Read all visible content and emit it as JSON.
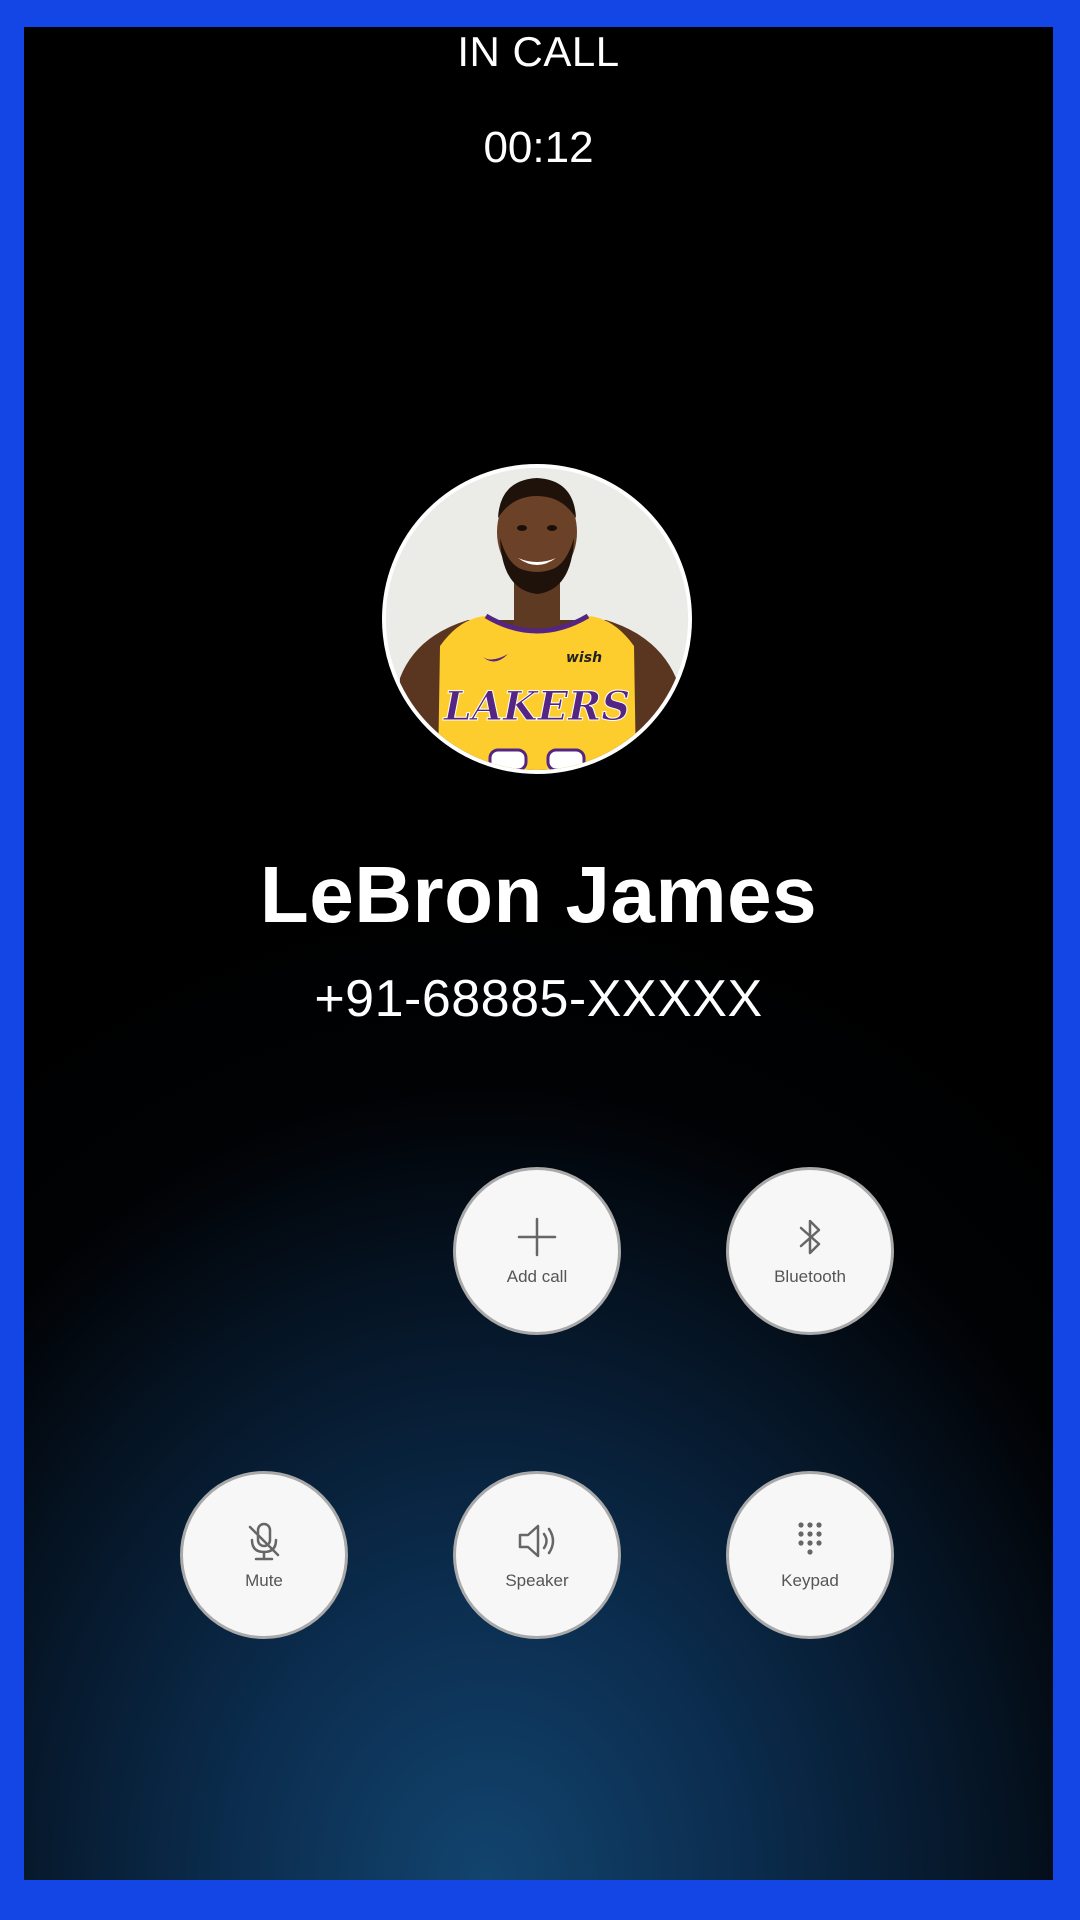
{
  "call": {
    "state": "IN CALL",
    "timer": "00:12"
  },
  "contact": {
    "name": "LeBron James",
    "number": "+91-68885-XXXXX",
    "avatar_jersey_text": "LAKERS",
    "avatar_sponsor_text": "wish"
  },
  "buttons": {
    "add_call": {
      "label": "Add call",
      "icon": "plus-icon"
    },
    "bluetooth": {
      "label": "Bluetooth",
      "icon": "bluetooth-icon"
    },
    "mute": {
      "label": "Mute",
      "icon": "mic-off-icon"
    },
    "speaker": {
      "label": "Speaker",
      "icon": "speaker-icon"
    },
    "keypad": {
      "label": "Keypad",
      "icon": "dialpad-icon"
    }
  },
  "colors": {
    "frame_border": "#1446e6",
    "background_top": "#000000",
    "background_bottom": "#12446f",
    "button_face": "#f7f7f7",
    "jersey_gold": "#fdcd2e",
    "jersey_purple": "#552583"
  }
}
